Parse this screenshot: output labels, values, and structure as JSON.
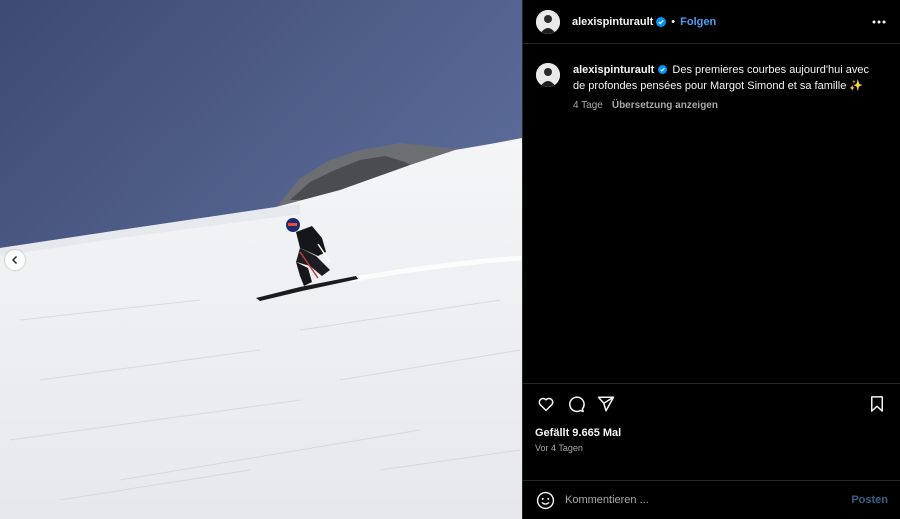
{
  "post": {
    "username": "alexispinturault",
    "follow_label": "Folgen",
    "separator": "•",
    "more_icon": "more-horizontal-icon",
    "verified_icon": "verified-badge-icon",
    "verified_color": "#0095f6"
  },
  "caption": {
    "username": "alexispinturault",
    "text": "Des premieres courbes aujourd'hui avec de profondes pensées pour Margot Simond et sa famille ✨",
    "age": "4 Tage",
    "translate_label": "Übersetzung anzeigen"
  },
  "actions": {
    "like_icon": "heart-icon",
    "comment_icon": "comment-icon",
    "share_icon": "send-icon",
    "save_icon": "bookmark-icon"
  },
  "stats": {
    "likes_label": "Gefällt 9.665 Mal",
    "date_label": "Vor 4 Tagen"
  },
  "comment_box": {
    "emoji_icon": "emoji-icon",
    "placeholder": "Kommentieren ...",
    "post_label": "Posten"
  },
  "media": {
    "prev_icon": "chevron-left-icon"
  },
  "colors": {
    "background": "#000000",
    "link_blue": "#4d9ef5",
    "divider": "#262626",
    "sky": "#4b5a86"
  }
}
